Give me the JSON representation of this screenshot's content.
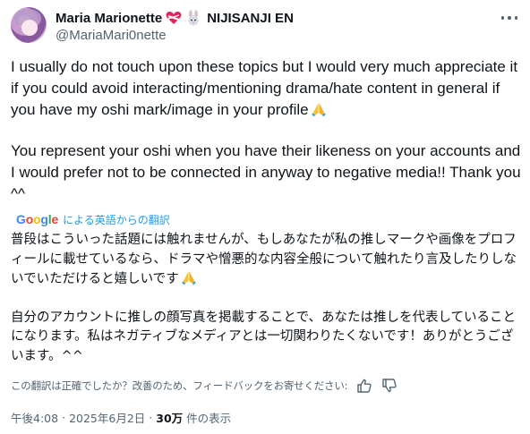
{
  "author": {
    "display_name": "Maria Marionette",
    "affiliation": "NIJISANJI EN",
    "handle": "@MariaMari0nette",
    "avatar_icon": "avatar-image",
    "heart_icon": "heart-ribbon-emoji",
    "rabbit_icon": "rabbit-emoji"
  },
  "more_icon": "more-options-icon",
  "post": {
    "para1": "I usually do not touch upon these topics but I would very much appreciate it if you could avoid interacting/mentioning drama/hate content in general if you have my oshi mark/image in your profile",
    "para2": "You represent your oshi when you have their likeness on your accounts and I would prefer not to be connected in anyway to negative media!! Thank you ^^",
    "pray_icon": "folded-hands-emoji"
  },
  "translation": {
    "provider": "Google",
    "label": "による英語からの翻訳",
    "para1": "普段はこういった話題には触れませんが、もしあなたが私の推しマークや画像をプロフィールに載せているなら、ドラマや憎悪的な内容全般について触れたり言及したりしないでいただけると嬉しいです",
    "para2": "自分のアカウントに推しの顔写真を掲載することで、あなたは推しを代表していることになります。私はネガティブなメディアとは一切関わりたくないです！ありがとうございます。^^",
    "feedback_prompt": "この翻訳は正確でしたか？改善のため、フィードバックをお寄せください:",
    "thumbs_up_icon": "thumbs-up-icon",
    "thumbs_down_icon": "thumbs-down-icon"
  },
  "meta": {
    "time": "午後4:08",
    "separator": "·",
    "date": "2025年6月2日",
    "separator2": "·",
    "views_count": "30万",
    "views_label": "件の表示"
  },
  "colors": {
    "text": "#0f1419",
    "secondary": "#536471",
    "link": "#1d9bf0"
  }
}
